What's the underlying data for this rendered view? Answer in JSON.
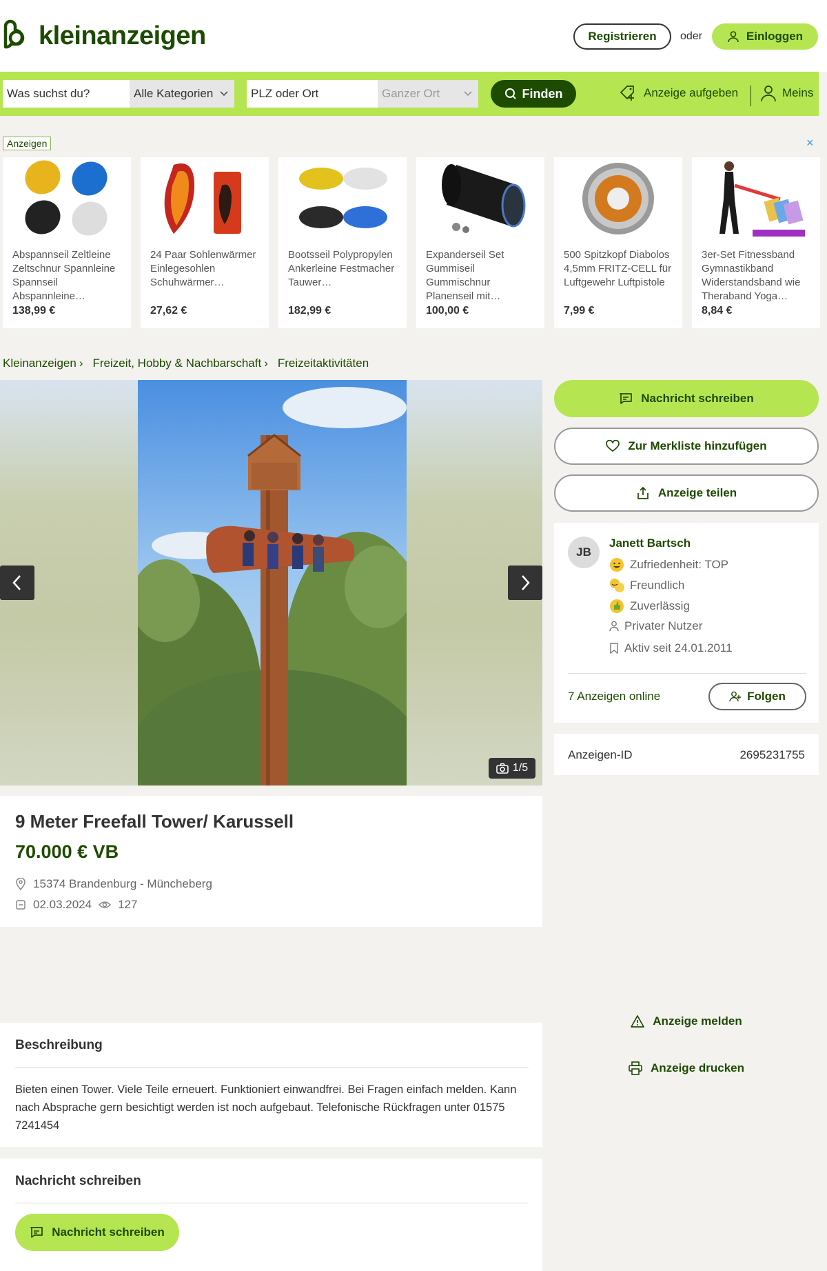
{
  "header": {
    "logo_text": "kleinanzeigen",
    "register_label": "Registrieren",
    "or_label": "oder",
    "login_label": "Einloggen"
  },
  "search": {
    "query_placeholder": "Was suchst du?",
    "category_value": "Alle Kategorien",
    "location_placeholder": "PLZ oder Ort",
    "radius_value": "Ganzer Ort",
    "find_label": "Finden",
    "post_ad_label": "Anzeige aufgeben",
    "my_label": "Meins"
  },
  "ads": {
    "label": "Anzeigen",
    "close_icon": "×",
    "items": [
      {
        "title": "Abspannseil Zeltleine Zeltschnur Spannleine Spannseil Abspannleine…",
        "price": "138,99 €",
        "icon": "rope-bundle-icon"
      },
      {
        "title": "24 Paar Sohlenwärmer Einlegesohlen Schuhwärmer…",
        "price": "27,62 €",
        "icon": "insole-warmer-icon"
      },
      {
        "title": "Bootsseil Polypropylen Ankerleine Festmacher Tauwer…",
        "price": "182,99 €",
        "icon": "boat-rope-icon"
      },
      {
        "title": "Expanderseil Set Gummiseil Gummischnur Planenseil mit…",
        "price": "100,00 €",
        "icon": "rope-spool-icon"
      },
      {
        "title": "500 Spitzkopf Diabolos 4,5mm FRITZ-CELL für Luftgewehr Luftpistole",
        "price": "7,99 €",
        "icon": "pellet-tin-icon"
      },
      {
        "title": "3er-Set Fitnessband Gymnastikband Widerstandsband wie Theraband Yoga…",
        "price": "8,84 €",
        "icon": "fitness-band-icon"
      }
    ]
  },
  "breadcrumb": [
    "Kleinanzeigen",
    "Freizeit, Hobby & Nachbarschaft",
    "Freizeitaktivitäten"
  ],
  "gallery": {
    "counter": "1/5"
  },
  "listing": {
    "title": "9 Meter Freefall Tower/ Karussell",
    "price": "70.000 € VB",
    "location": "15374 Brandenburg - Müncheberg",
    "date": "02.03.2024",
    "views": "127"
  },
  "actions": {
    "message_label": "Nachricht schreiben",
    "watchlist_label": "Zur Merkliste hinzufügen",
    "share_label": "Anzeige teilen",
    "report_label": "Anzeige melden",
    "print_label": "Anzeige drucken"
  },
  "seller": {
    "initials": "JB",
    "name": "Janett Bartsch",
    "satisfaction": "Zufriedenheit: TOP",
    "badge_friendly": "Freundlich",
    "badge_reliable": "Zuverlässig",
    "type": "Privater Nutzer",
    "active_since": "Aktiv seit 24.01.2011",
    "ads_online": "7 Anzeigen online",
    "follow_label": "Folgen"
  },
  "ad_id": {
    "label": "Anzeigen-ID",
    "value": "2695231755"
  },
  "description": {
    "heading": "Beschreibung",
    "text": "Bieten einen Tower. Viele Teile erneuert. Funktioniert einwandfrei. Bei Fragen einfach melden. Kann nach Absprache gern besichtigt werden ist noch aufgebaut. Telefonische Rückfragen unter 01575 7241454"
  },
  "message_section": {
    "heading": "Nachricht schreiben",
    "button_label": "Nachricht schreiben"
  },
  "colors": {
    "brand_green": "#1d4b00",
    "accent_lime": "#b5e550"
  }
}
